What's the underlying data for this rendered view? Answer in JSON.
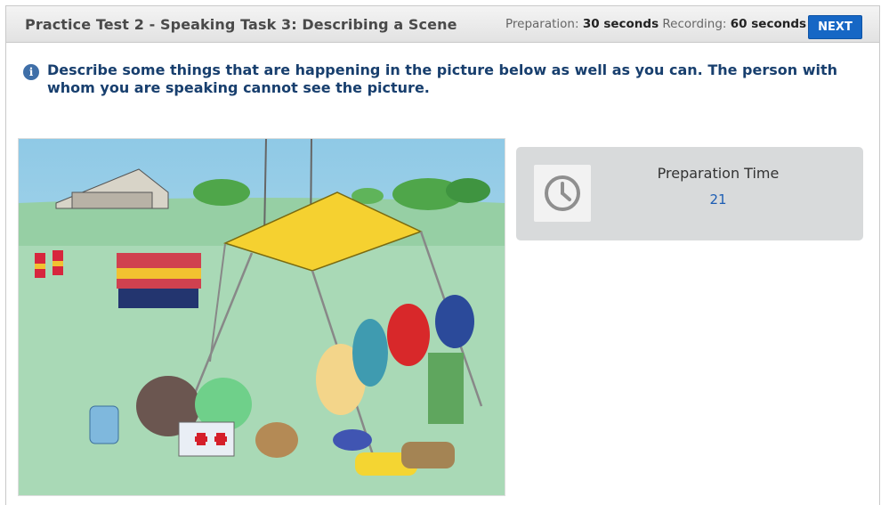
{
  "header": {
    "title": "Practice Test 2 - Speaking Task 3: Describing a Scene",
    "preparation_label": "Preparation:",
    "preparation_value": "30 seconds",
    "recording_label": "Recording:",
    "recording_value": "60 seconds",
    "next_label": "NEXT"
  },
  "instructions": {
    "icon": "info-icon",
    "text": "Describe some things that are happening in the picture below as well as you can. The person with whom you are speaking cannot see the picture."
  },
  "timer_panel": {
    "icon": "clock-icon",
    "label": "Preparation Time",
    "count": "21"
  },
  "colors": {
    "accent": "#1667c5",
    "instruction_text": "#183f6e",
    "panel_bg": "#d8dadb"
  }
}
